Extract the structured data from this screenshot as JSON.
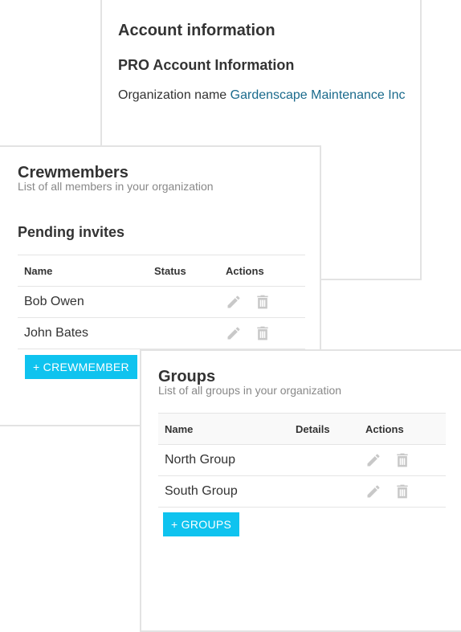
{
  "account": {
    "title": "Account information",
    "subtitle": "PRO Account Information",
    "org_label": "Organization name",
    "org_value": "Gardenscape Maintenance Inc"
  },
  "crew": {
    "title": "Crewmembers",
    "subtitle": "List of all members in your organization",
    "section_title": "Pending invites",
    "columns": [
      "Name",
      "Status",
      "Actions"
    ],
    "rows": [
      {
        "name": "Bob Owen",
        "status": ""
      },
      {
        "name": "John Bates",
        "status": ""
      }
    ],
    "add_button": "+ CREWMEMBER"
  },
  "groups": {
    "title": "Groups",
    "subtitle": "List of all groups in your organization",
    "columns": [
      "Name",
      "Details",
      "Actions"
    ],
    "rows": [
      {
        "name": "North Group",
        "details": ""
      },
      {
        "name": "South Group",
        "details": ""
      }
    ],
    "add_button": "+ GROUPS"
  },
  "icons": {
    "edit": "pencil-icon",
    "delete": "trash-icon"
  },
  "colors": {
    "accent": "#0fc3ef",
    "link": "#1a6a8c",
    "icon": "#c8c8c8"
  }
}
